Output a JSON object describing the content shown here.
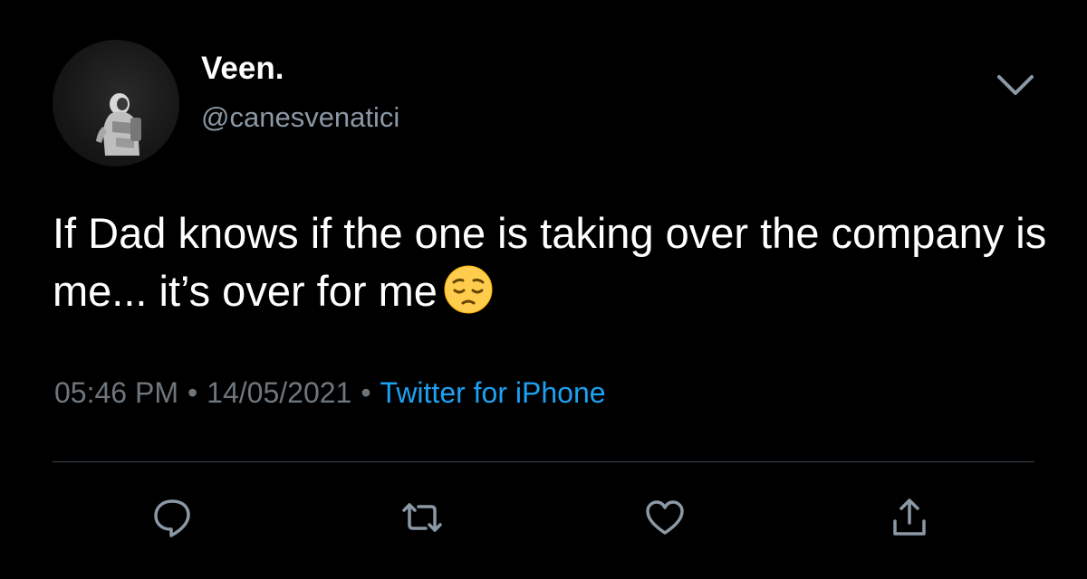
{
  "tweet": {
    "display_name": "Veen.",
    "handle": "@canesvenatici",
    "text": "If Dad knows if the one is taking over the company is me... it’s over for me",
    "emoji": "pensive-face",
    "time": "05:46 PM",
    "date": "14/05/2021",
    "separator": "•",
    "source": "Twitter for iPhone"
  },
  "icons": {
    "more": "chevron-down-icon",
    "reply": "reply-icon",
    "retweet": "retweet-icon",
    "like": "heart-icon",
    "share": "share-icon"
  },
  "colors": {
    "background": "#000000",
    "text": "#ffffff",
    "secondary_text": "#8b98a5",
    "meta_text": "#6e767d",
    "link": "#1da1f2",
    "divider": "#38444d",
    "icon": "#8b98a5"
  }
}
